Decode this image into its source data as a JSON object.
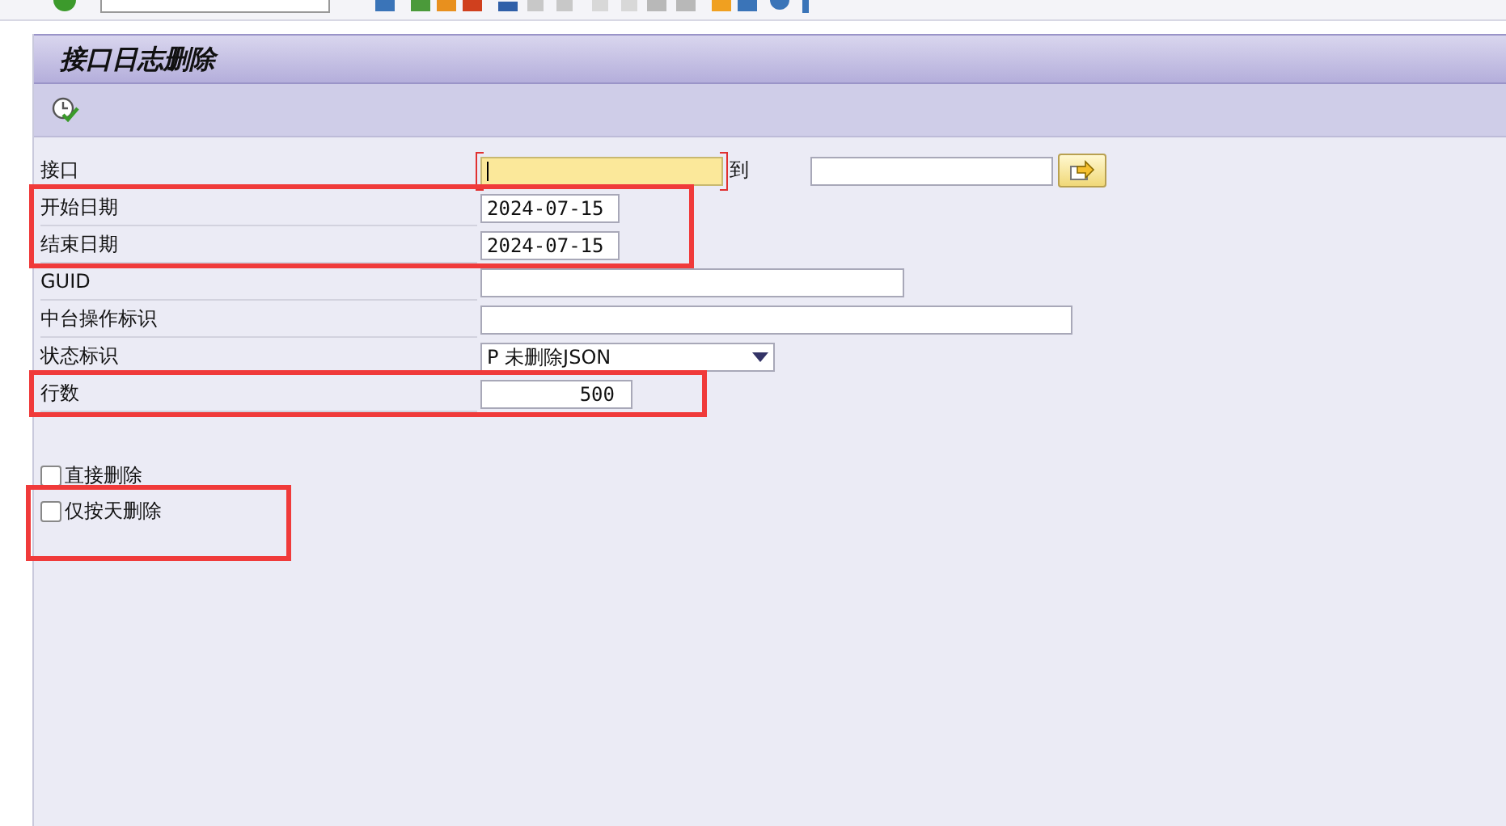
{
  "title": "接口日志删除",
  "groups": [
    {
      "highlighted": false,
      "rows": [
        {
          "kind": "range",
          "label": "接口",
          "focused": true,
          "to_label": "到"
        }
      ]
    },
    {
      "highlighted": true,
      "rows": [
        {
          "kind": "date",
          "label": "开始日期",
          "value": "2024-07-15"
        },
        {
          "kind": "date",
          "label": "结束日期",
          "value": "2024-07-15"
        }
      ]
    },
    {
      "highlighted": false,
      "rows": [
        {
          "kind": "medium",
          "label": "GUID"
        },
        {
          "kind": "long",
          "label": "中台操作标识"
        },
        {
          "kind": "select",
          "label": "状态标识",
          "value": "P 未删除JSON"
        }
      ]
    },
    {
      "highlighted": true,
      "rows": [
        {
          "kind": "number",
          "label": "行数",
          "value": "500"
        }
      ]
    }
  ],
  "checkboxes": [
    {
      "label": "直接删除",
      "checked": false,
      "highlighted": false
    },
    {
      "label": "仅按天删除",
      "checked": false,
      "highlighted": true
    }
  ]
}
